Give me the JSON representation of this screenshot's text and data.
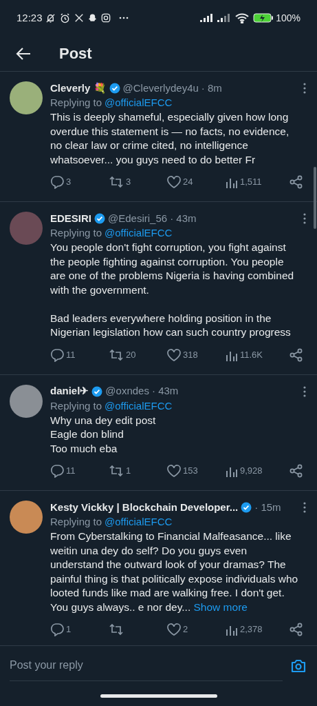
{
  "status_bar": {
    "time": "12:23",
    "battery": "100%"
  },
  "header": {
    "title": "Post"
  },
  "replies": [
    {
      "name": "Cleverly 💐",
      "verified": true,
      "handle": "@Cleverlydey4u",
      "time": "· 8m",
      "replying_label": "Replying to",
      "replying_to": "@officialEFCC",
      "text": "This is deeply shameful, especially given how long overdue this statement is — no facts, no evidence, no clear law or crime cited, no intelligence whatsoever... you guys need to do better Fr",
      "stats": {
        "replies": "3",
        "reposts": "3",
        "likes": "24",
        "views": "1,511"
      }
    },
    {
      "name": "EDESIRI",
      "verified": true,
      "handle": "@Edesiri_56",
      "time": "· 43m",
      "replying_label": "Replying to",
      "replying_to": "@officialEFCC",
      "text": "You people don't fight corruption, you fight against the people fighting against corruption. You people are one of the problems Nigeria is having combined with the government.\n\nBad leaders everywhere holding position in the Nigerian legislation how can such country progress",
      "stats": {
        "replies": "11",
        "reposts": "20",
        "likes": "318",
        "views": "11.6K"
      }
    },
    {
      "name": "daniel✈",
      "verified": true,
      "handle": "@oxndes",
      "time": "· 43m",
      "replying_label": "Replying to",
      "replying_to": "@officialEFCC",
      "text": "Why una dey edit post\nEagle don blind\nToo much eba",
      "stats": {
        "replies": "11",
        "reposts": "1",
        "likes": "153",
        "views": "9,928"
      }
    },
    {
      "name": "Kesty Vickky | Blockchain Developer...",
      "verified": true,
      "time": "· 15m",
      "replying_label": "Replying to",
      "replying_to": "@officialEFCC",
      "text": "From Cyberstalking to Financial Malfeasance... like weitin una dey do self?  Do you guys even understand the outward look of your dramas? The painful thing is that politically expose individuals who looted funds like mad are walking free. I don't get. You guys always.. e nor dey...",
      "show_more": "Show more",
      "stats": {
        "replies": "1",
        "likes": "2",
        "views": "2,378"
      }
    }
  ],
  "reply_bar": {
    "placeholder": "Post your reply"
  }
}
